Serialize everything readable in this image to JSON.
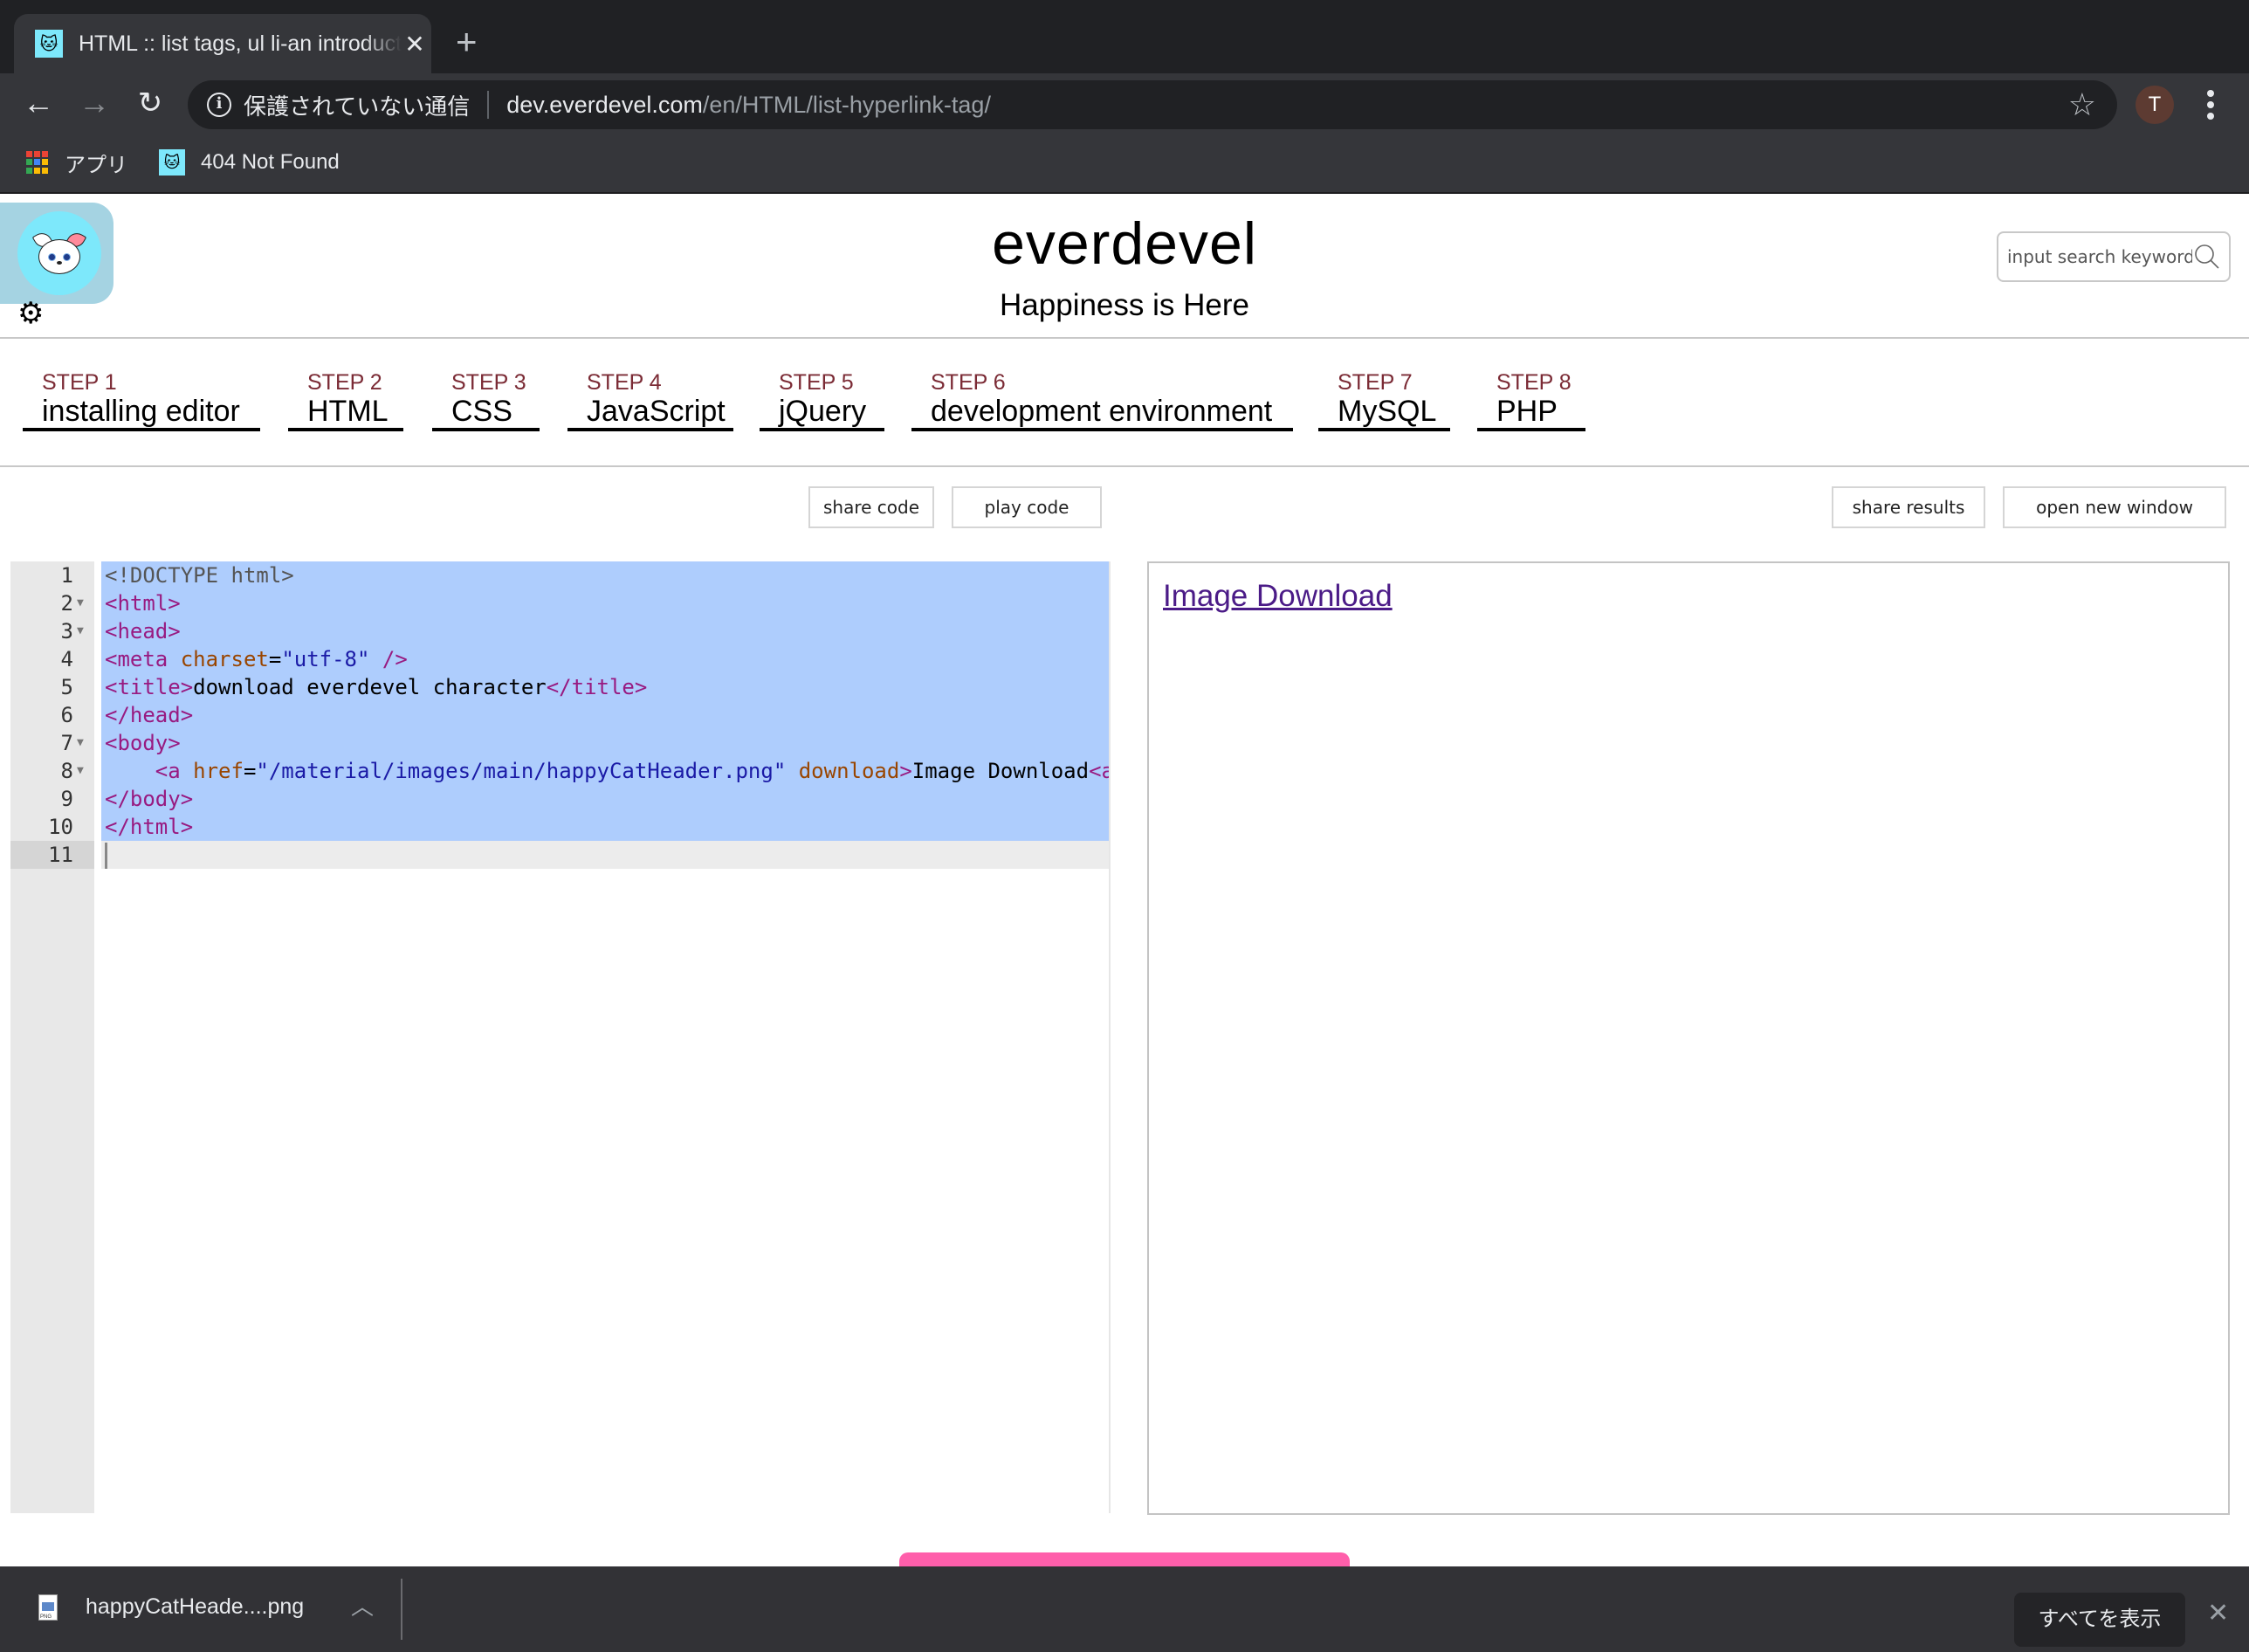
{
  "browser": {
    "tab_title": "HTML :: list tags, ul li-an introduction",
    "new_tab_icon": "plus-icon",
    "security_label": "保護されていない通信",
    "url_host": "dev.everdevel.com",
    "url_path": "/en/HTML/list-hyperlink-tag/",
    "avatar_letter": "T",
    "bookmarks": [
      {
        "label": "アプリ",
        "icon": "apps-grid-icon"
      },
      {
        "label": "404 Not Found",
        "icon": "cat-favicon"
      }
    ]
  },
  "header": {
    "title": "everdevel",
    "subtitle": "Happiness is Here",
    "search_placeholder": "input search keyword"
  },
  "steps": [
    {
      "num": "STEP 1",
      "name": "installing editor"
    },
    {
      "num": "STEP 2",
      "name": "HTML"
    },
    {
      "num": "STEP 3",
      "name": "CSS"
    },
    {
      "num": "STEP 4",
      "name": "JavaScript"
    },
    {
      "num": "STEP 5",
      "name": "jQuery"
    },
    {
      "num": "STEP 6",
      "name": "development environment"
    },
    {
      "num": "STEP 7",
      "name": "MySQL"
    },
    {
      "num": "STEP 8",
      "name": "PHP"
    }
  ],
  "actions": {
    "share_code": "share code",
    "play_code": "play code",
    "share_results": "share results",
    "open_new_window": "open new window"
  },
  "editor": {
    "active_line": 11,
    "lines": [
      {
        "n": "1",
        "fold": false,
        "tokens": [
          [
            "doc",
            "<!DOCTYPE html>"
          ]
        ]
      },
      {
        "n": "2",
        "fold": true,
        "tokens": [
          [
            "tag",
            "<html>"
          ]
        ]
      },
      {
        "n": "3",
        "fold": true,
        "tokens": [
          [
            "tag",
            "<head>"
          ]
        ]
      },
      {
        "n": "4",
        "fold": false,
        "tokens": [
          [
            "tag",
            "<meta "
          ],
          [
            "attr",
            "charset"
          ],
          [
            "txt",
            "="
          ],
          [
            "str",
            "\"utf-8\""
          ],
          [
            "tag",
            " />"
          ]
        ]
      },
      {
        "n": "5",
        "fold": false,
        "tokens": [
          [
            "tag",
            "<title>"
          ],
          [
            "txt",
            "download everdevel character"
          ],
          [
            "tag",
            "</title>"
          ]
        ]
      },
      {
        "n": "6",
        "fold": false,
        "tokens": [
          [
            "tag",
            "</head>"
          ]
        ]
      },
      {
        "n": "7",
        "fold": true,
        "tokens": [
          [
            "tag",
            "<body>"
          ]
        ]
      },
      {
        "n": "8",
        "fold": true,
        "tokens": [
          [
            "txt",
            "    "
          ],
          [
            "tag",
            "<a "
          ],
          [
            "attr",
            "href"
          ],
          [
            "txt",
            "="
          ],
          [
            "str",
            "\"/material/images/main/happyCatHeader.png\""
          ],
          [
            "txt",
            " "
          ],
          [
            "attr",
            "download"
          ],
          [
            "tag",
            ">"
          ],
          [
            "txt",
            "Image Download"
          ],
          [
            "tag",
            "<a>"
          ]
        ]
      },
      {
        "n": "9",
        "fold": false,
        "tokens": [
          [
            "tag",
            "</body>"
          ]
        ]
      },
      {
        "n": "10",
        "fold": false,
        "tokens": [
          [
            "tag",
            "</html>"
          ]
        ]
      },
      {
        "n": "11",
        "fold": false,
        "tokens": []
      }
    ]
  },
  "preview": {
    "link_text": "Image Download"
  },
  "download_bar": {
    "file_name": "happyCatHeade....png",
    "show_all": "すべてを表示"
  },
  "colors": {
    "step_number": "#7b2b35",
    "selection": "#aecdfd",
    "preview_link": "#4b1b87",
    "pink_button": "#ff5fab",
    "logo_bg": "#7de8fb"
  }
}
